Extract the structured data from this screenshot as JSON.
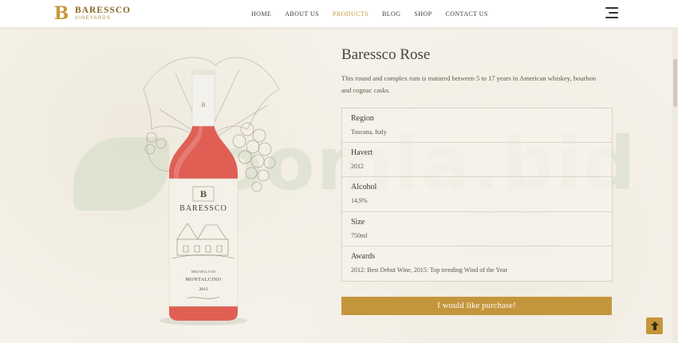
{
  "brand": {
    "mark": "B",
    "name": "BARESSCO",
    "sub": "VINEYARDS"
  },
  "nav": {
    "items": [
      {
        "label": "HOME"
      },
      {
        "label": "ABOUT US"
      },
      {
        "label": "PRODUCTS",
        "active": true
      },
      {
        "label": "BLOG"
      },
      {
        "label": "SHOP"
      },
      {
        "label": "CONTACT US"
      }
    ]
  },
  "watermark": "Joomla.bid",
  "bottle": {
    "brand": "BARESSCO",
    "mark": "B",
    "region": "MONTALCINO",
    "year": "2012",
    "color": "#e05f55"
  },
  "product": {
    "title": "Baressco Rose",
    "description": "This round and complex rum is matured between 5 to 17 years in American whiskey, bourbon and cognac casks.",
    "specs": [
      {
        "label": "Region",
        "value": "Toscana, Italy"
      },
      {
        "label": "Havert",
        "value": "2012"
      },
      {
        "label": "Alcohol",
        "value": "14,9%"
      },
      {
        "label": "Size",
        "value": "750ml"
      },
      {
        "label": "Awards",
        "value": "2012: Best Debut Wine, 2015: Top trending Wind of the Year"
      }
    ],
    "button_label": "I would like purchase!"
  },
  "colors": {
    "accent": "#c4963c",
    "bottle": "#e05f55"
  },
  "icons": {
    "menu": "hamburger-icon",
    "scroll_top": "arrow-up-icon"
  }
}
